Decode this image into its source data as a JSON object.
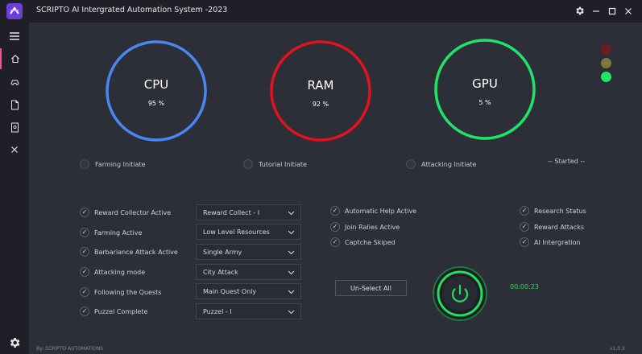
{
  "window": {
    "title": "SCRIPTO AI Intergrated Automation System -2023",
    "settings_icon": "gear-icon",
    "minimize_icon": "minimize-icon",
    "maximize_icon": "maximize-icon",
    "close_icon": "close-icon"
  },
  "sidebar": {
    "items": [
      {
        "name": "menu",
        "icon": "hamburger-icon"
      },
      {
        "name": "home",
        "icon": "home-icon"
      },
      {
        "name": "games",
        "icon": "gamepad-icon"
      },
      {
        "name": "documents",
        "icon": "document-icon"
      },
      {
        "name": "files",
        "icon": "file-icon"
      },
      {
        "name": "close",
        "icon": "close-icon"
      }
    ],
    "bottom_icon": "gear-icon",
    "active": "home"
  },
  "gauges": [
    {
      "label": "CPU",
      "value": "95 %",
      "percent": 95,
      "color": "#4a86f0"
    },
    {
      "label": "RAM",
      "value": "92 %",
      "percent": 92,
      "color": "#e0141e"
    },
    {
      "label": "GPU",
      "value": "5 %",
      "percent": 5,
      "color": "#1fe36b"
    }
  ],
  "status_lights": [
    {
      "state": "off",
      "color": "#6b1c1c"
    },
    {
      "state": "off",
      "color": "#7a7a3a"
    },
    {
      "state": "on",
      "color": "#25e36a"
    }
  ],
  "initiate_options": [
    {
      "label": "Farming Initiate"
    },
    {
      "label": "Tutorial Initiate"
    },
    {
      "label": "Attacking Initiate"
    }
  ],
  "status": "-- Started --",
  "left_options": [
    {
      "label": "Reward Collector Active",
      "checked": true,
      "select": "Reward Collect - I"
    },
    {
      "label": "Farming Active",
      "checked": true,
      "select": "Low Level Resources"
    },
    {
      "label": "Barbariance Attack Active",
      "checked": true,
      "select": "Single Army"
    },
    {
      "label": "Attacking mode",
      "checked": true,
      "select": "City Attack"
    },
    {
      "label": "Following the Quests",
      "checked": true,
      "select": "Main Quest Only"
    },
    {
      "label": "Puzzel Complete",
      "checked": true,
      "select": "Puzzel - I"
    }
  ],
  "middle_options": [
    {
      "label": "Automatic Help Active",
      "checked": true
    },
    {
      "label": "Join Ralies Active",
      "checked": true
    },
    {
      "label": "Captcha Skiped",
      "checked": true
    }
  ],
  "right_options": [
    {
      "label": "Research Status",
      "checked": true
    },
    {
      "label": "Reward Attacks",
      "checked": true
    },
    {
      "label": "AI Intergration",
      "checked": true
    }
  ],
  "unselect_label": "Un-Select All",
  "power": {
    "icon": "power-icon",
    "color": "#1fe36b"
  },
  "timer": "00:00:23",
  "footer": "By: SCRIPTO AUTOMATIONS",
  "version": "v1.0.3"
}
